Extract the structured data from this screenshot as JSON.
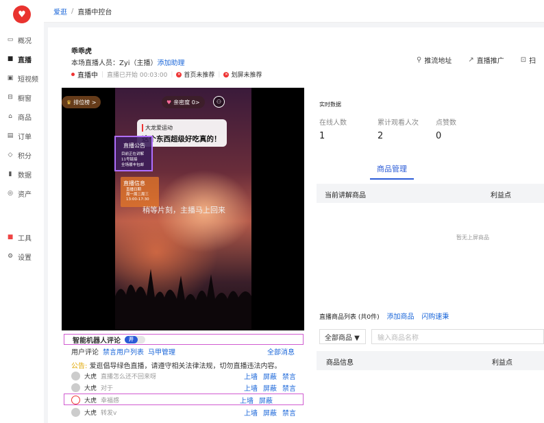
{
  "app": {
    "logo_icon": "heart-logo-icon"
  },
  "breadcrumb": {
    "root": "爱逛",
    "separator": "/",
    "current": "直播中控台"
  },
  "sidebar": {
    "items": [
      {
        "label": "概况",
        "icon": "chart-icon"
      },
      {
        "label": "直播",
        "icon": "video-icon",
        "active": true
      },
      {
        "label": "短视频",
        "icon": "play-icon"
      },
      {
        "label": "橱窗",
        "icon": "shop-window-icon"
      },
      {
        "label": "商品",
        "icon": "bag-icon"
      },
      {
        "label": "订单",
        "icon": "order-icon"
      },
      {
        "label": "积分",
        "icon": "points-icon"
      },
      {
        "label": "数据",
        "icon": "bar-chart-icon"
      },
      {
        "label": "资产",
        "icon": "asset-icon"
      },
      {
        "label": "工具",
        "icon": "grid-icon"
      },
      {
        "label": "设置",
        "icon": "gear-icon"
      }
    ]
  },
  "header": {
    "name": "乖乖虎",
    "staff_text": "本场直播人员：Zyi（主播）",
    "add_assistant": "添加助理",
    "status_live": "直播中",
    "status_started": "直播已开始 00:03:00",
    "status_home": "首页未推荐",
    "status_swipe": "划屏未推荐"
  },
  "actions": {
    "stream_url": "推流地址",
    "promote": "直播推广",
    "scan": "扫"
  },
  "video": {
    "rank_label": "排位榜 >",
    "intimacy_label": "亲密度 0>",
    "bubble_nick": "大龙爱运动",
    "bubble_text": "这个东西超级好吃真的！",
    "notice_title": "直播公告",
    "notice_line1": "目前正在讲解",
    "notice_line2": "11号链接",
    "notice_line3": "全场顺丰包邮",
    "live_title": "直播信息",
    "live_line1": "直播日期",
    "live_line2": "周一周二周三",
    "live_line3": "13:00-17:30",
    "wait_text": "稍等片刻，主播马上回来"
  },
  "robot": {
    "label": "智能机器人评论",
    "toggle": "开"
  },
  "comments_panel": {
    "tab_user": "用户评论",
    "tab_banned": "禁言用户列表",
    "tab_vest": "马甲管理",
    "all_messages": "全部消息",
    "announce_label": "公告:",
    "announce_text": "爱逛倡导绿色直播，请遵守相关法律法规，切勿直播违法内容。",
    "op_wall": "上墙",
    "op_block": "屏蔽",
    "op_mute": "禁言",
    "items": [
      {
        "nick": "大虎",
        "text": "直播怎么还不回来呀"
      },
      {
        "nick": "大虎",
        "text": "对于"
      },
      {
        "nick": "大虎",
        "text": "幸福感",
        "robot": true
      },
      {
        "nick": "大虎",
        "text": "转发v"
      }
    ]
  },
  "realtime": {
    "title": "实时数据",
    "online_label": "在线人数",
    "online_value": "1",
    "total_label": "累计观看人次",
    "total_value": "2",
    "likes_label": "点赞数",
    "likes_value": "0"
  },
  "goods": {
    "tab_manage": "商品管理",
    "tab_other": "",
    "current_header": "当前讲解商品",
    "benefit_header": "利益点",
    "empty_text": "暂无上屏商品",
    "list_title": "直播商品列表 (共0件)",
    "add_goods": "添加商品",
    "flash_sale": "闪购速秉",
    "select_label": "全部商品 ▼",
    "search_placeholder": "输入商品名称",
    "info_header": "商品信息"
  }
}
